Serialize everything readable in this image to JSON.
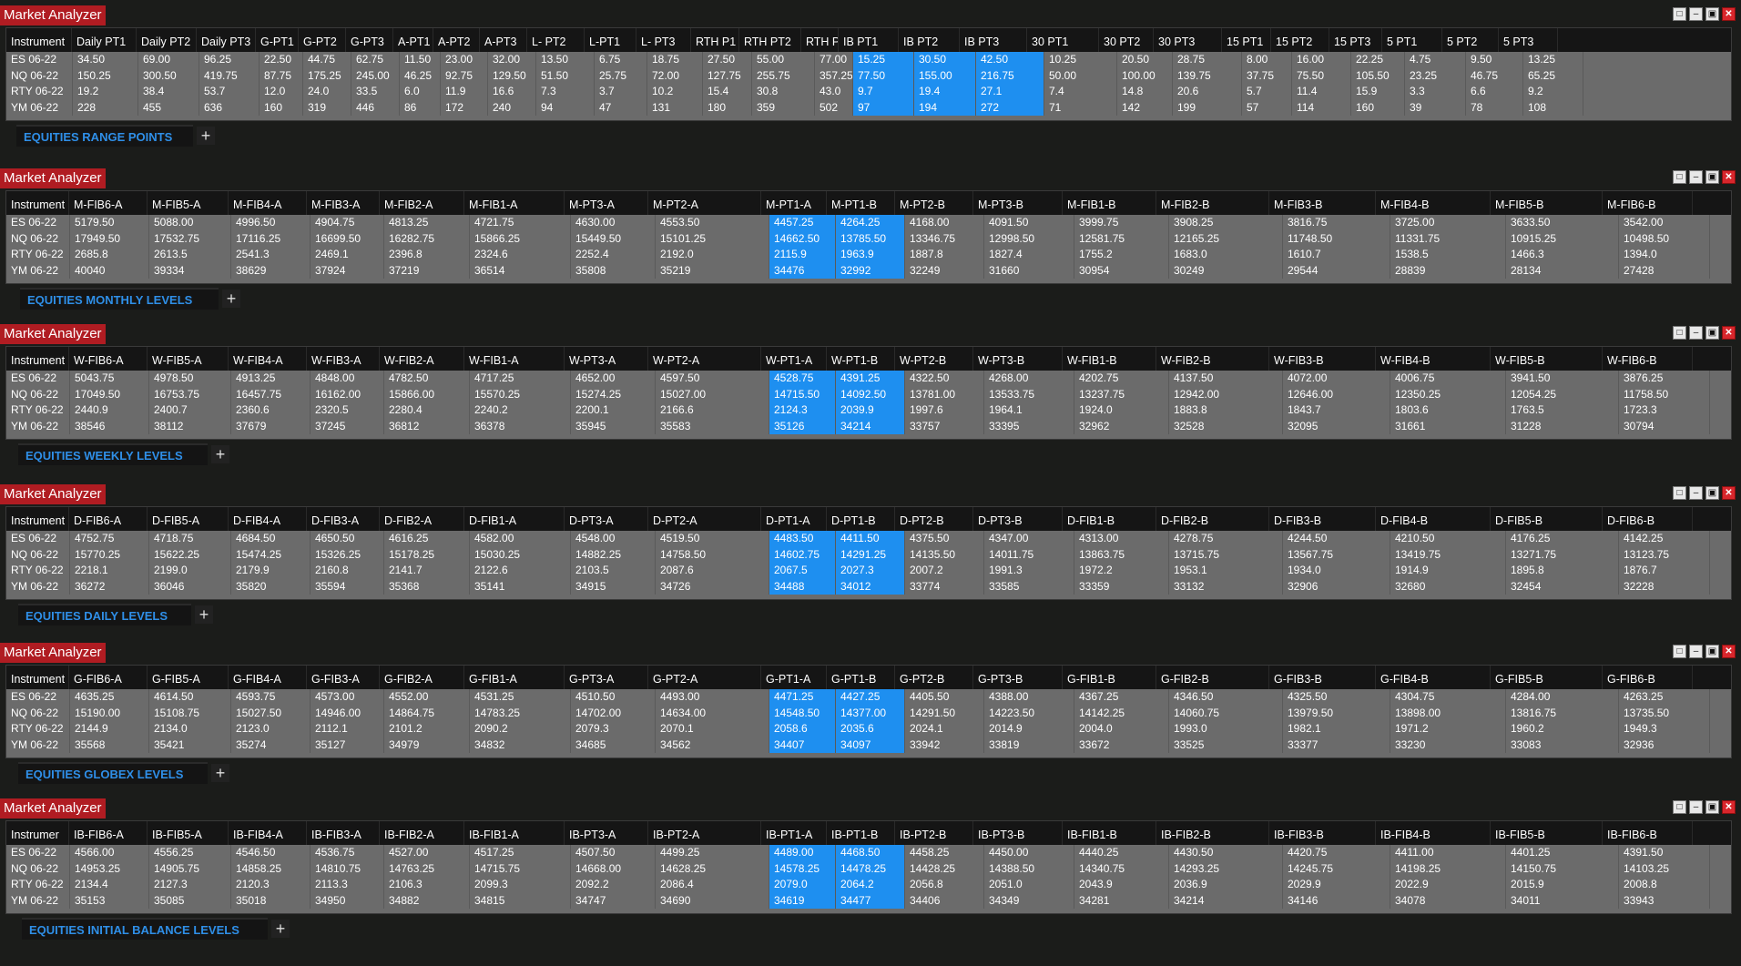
{
  "window_title": "Market Analyzer",
  "colors": {
    "title_bg": "#b01c22",
    "highlight": "#1e8ff0",
    "tab_text": "#2f8fe8",
    "grid_bg": "#6b6b6b"
  },
  "window_buttons": [
    "window-icon",
    "minimize-icon",
    "maximize-icon",
    "close-icon"
  ],
  "windows": [
    {
      "tab": "EQUITIES RANGE POINTS",
      "highlight_columns": [
        "IB PT1",
        "IB PT2",
        "IB PT3"
      ],
      "columns": [
        "Instrument",
        "Daily PT1",
        "Daily PT2",
        "Daily PT3",
        "G-PT1",
        "G-PT2",
        "G-PT3",
        "A-PT1",
        "A-PT2",
        "A-PT3",
        "L- PT2",
        "L-PT1",
        "L- PT3",
        "RTH P1",
        "RTH PT2",
        "RTH P",
        "IB PT1",
        "IB PT2",
        "IB PT3",
        "30 PT1",
        "30 PT2",
        "30 PT3",
        "15 PT1",
        "15 PT2",
        "15 PT3",
        "5 PT1",
        "5 PT2",
        "5 PT3"
      ],
      "rows": [
        [
          "ES 06-22",
          "34.50",
          "69.00",
          "96.25",
          "22.50",
          "44.75",
          "62.75",
          "11.50",
          "23.00",
          "32.00",
          "13.50",
          "6.75",
          "18.75",
          "27.50",
          "55.00",
          "77.00",
          "15.25",
          "30.50",
          "42.50",
          "10.25",
          "20.50",
          "28.75",
          "8.00",
          "16.00",
          "22.25",
          "4.75",
          "9.50",
          "13.25"
        ],
        [
          "NQ 06-22",
          "150.25",
          "300.50",
          "419.75",
          "87.75",
          "175.25",
          "245.00",
          "46.25",
          "92.75",
          "129.50",
          "51.50",
          "25.75",
          "72.00",
          "127.75",
          "255.75",
          "357.25",
          "77.50",
          "155.00",
          "216.75",
          "50.00",
          "100.00",
          "139.75",
          "37.75",
          "75.50",
          "105.50",
          "23.25",
          "46.75",
          "65.25"
        ],
        [
          "RTY 06-22",
          "19.2",
          "38.4",
          "53.7",
          "12.0",
          "24.0",
          "33.5",
          "6.0",
          "11.9",
          "16.6",
          "7.3",
          "3.7",
          "10.2",
          "15.4",
          "30.8",
          "43.0",
          "9.7",
          "19.4",
          "27.1",
          "7.4",
          "14.8",
          "20.6",
          "5.7",
          "11.4",
          "15.9",
          "3.3",
          "6.6",
          "9.2"
        ],
        [
          "YM 06-22",
          "228",
          "455",
          "636",
          "160",
          "319",
          "446",
          "86",
          "172",
          "240",
          "94",
          "47",
          "131",
          "180",
          "359",
          "502",
          "97",
          "194",
          "272",
          "71",
          "142",
          "199",
          "57",
          "114",
          "160",
          "39",
          "78",
          "108"
        ]
      ]
    },
    {
      "tab": "EQUITIES MONTHLY LEVELS",
      "highlight_columns": [
        "M-PT1-A",
        "M-PT1-B"
      ],
      "columns": [
        "Instrument",
        "M-FIB6-A",
        "M-FIB5-A",
        "M-FIB4-A",
        "M-FIB3-A",
        "M-FIB2-A",
        "M-FIB1-A",
        "M-PT3-A",
        "M-PT2-A",
        "M-PT1-A",
        "M-PT1-B",
        "M-PT2-B",
        "M-PT3-B",
        "M-FIB1-B",
        "M-FIB2-B",
        "M-FIB3-B",
        "M-FIB4-B",
        "M-FIB5-B",
        "M-FIB6-B"
      ],
      "rows": [
        [
          "ES 06-22",
          "5179.50",
          "5088.00",
          "4996.50",
          "4904.75",
          "4813.25",
          "4721.75",
          "4630.00",
          "4553.50",
          "4457.25",
          "4264.25",
          "4168.00",
          "4091.50",
          "3999.75",
          "3908.25",
          "3816.75",
          "3725.00",
          "3633.50",
          "3542.00"
        ],
        [
          "NQ 06-22",
          "17949.50",
          "17532.75",
          "17116.25",
          "16699.50",
          "16282.75",
          "15866.25",
          "15449.50",
          "15101.25",
          "14662.50",
          "13785.50",
          "13346.75",
          "12998.50",
          "12581.75",
          "12165.25",
          "11748.50",
          "11331.75",
          "10915.25",
          "10498.50"
        ],
        [
          "RTY 06-22",
          "2685.8",
          "2613.5",
          "2541.3",
          "2469.1",
          "2396.8",
          "2324.6",
          "2252.4",
          "2192.0",
          "2115.9",
          "1963.9",
          "1887.8",
          "1827.4",
          "1755.2",
          "1683.0",
          "1610.7",
          "1538.5",
          "1466.3",
          "1394.0"
        ],
        [
          "YM 06-22",
          "40040",
          "39334",
          "38629",
          "37924",
          "37219",
          "36514",
          "35808",
          "35219",
          "34476",
          "32992",
          "32249",
          "31660",
          "30954",
          "30249",
          "29544",
          "28839",
          "28134",
          "27428"
        ]
      ]
    },
    {
      "tab": "EQUITIES WEEKLY LEVELS",
      "highlight_columns": [
        "W-PT1-A",
        "W-PT1-B"
      ],
      "columns": [
        "Instrument",
        "W-FIB6-A",
        "W-FIB5-A",
        "W-FIB4-A",
        "W-FIB3-A",
        "W-FIB2-A",
        "W-FIB1-A",
        "W-PT3-A",
        "W-PT2-A",
        "W-PT1-A",
        "W-PT1-B",
        "W-PT2-B",
        "W-PT3-B",
        "W-FIB1-B",
        "W-FIB2-B",
        "W-FIB3-B",
        "W-FIB4-B",
        "W-FIB5-B",
        "W-FIB6-B"
      ],
      "rows": [
        [
          "ES 06-22",
          "5043.75",
          "4978.50",
          "4913.25",
          "4848.00",
          "4782.50",
          "4717.25",
          "4652.00",
          "4597.50",
          "4528.75",
          "4391.25",
          "4322.50",
          "4268.00",
          "4202.75",
          "4137.50",
          "4072.00",
          "4006.75",
          "3941.50",
          "3876.25"
        ],
        [
          "NQ 06-22",
          "17049.50",
          "16753.75",
          "16457.75",
          "16162.00",
          "15866.00",
          "15570.25",
          "15274.25",
          "15027.00",
          "14715.50",
          "14092.50",
          "13781.00",
          "13533.75",
          "13237.75",
          "12942.00",
          "12646.00",
          "12350.25",
          "12054.25",
          "11758.50"
        ],
        [
          "RTY 06-22",
          "2440.9",
          "2400.7",
          "2360.6",
          "2320.5",
          "2280.4",
          "2240.2",
          "2200.1",
          "2166.6",
          "2124.3",
          "2039.9",
          "1997.6",
          "1964.1",
          "1924.0",
          "1883.8",
          "1843.7",
          "1803.6",
          "1763.5",
          "1723.3"
        ],
        [
          "YM 06-22",
          "38546",
          "38112",
          "37679",
          "37245",
          "36812",
          "36378",
          "35945",
          "35583",
          "35126",
          "34214",
          "33757",
          "33395",
          "32962",
          "32528",
          "32095",
          "31661",
          "31228",
          "30794"
        ]
      ]
    },
    {
      "tab": "EQUITIES DAILY LEVELS",
      "highlight_columns": [
        "D-PT1-A",
        "D-PT1-B"
      ],
      "columns": [
        "Instrument",
        "D-FIB6-A",
        "D-FIB5-A",
        "D-FIB4-A",
        "D-FIB3-A",
        "D-FIB2-A",
        "D-FIB1-A",
        "D-PT3-A",
        "D-PT2-A",
        "D-PT1-A",
        "D-PT1-B",
        "D-PT2-B",
        "D-PT3-B",
        "D-FIB1-B",
        "D-FIB2-B",
        "D-FIB3-B",
        "D-FIB4-B",
        "D-FIB5-B",
        "D-FIB6-B"
      ],
      "rows": [
        [
          "ES 06-22",
          "4752.75",
          "4718.75",
          "4684.50",
          "4650.50",
          "4616.25",
          "4582.00",
          "4548.00",
          "4519.50",
          "4483.50",
          "4411.50",
          "4375.50",
          "4347.00",
          "4313.00",
          "4278.75",
          "4244.50",
          "4210.50",
          "4176.25",
          "4142.25"
        ],
        [
          "NQ 06-22",
          "15770.25",
          "15622.25",
          "15474.25",
          "15326.25",
          "15178.25",
          "15030.25",
          "14882.25",
          "14758.50",
          "14602.75",
          "14291.25",
          "14135.50",
          "14011.75",
          "13863.75",
          "13715.75",
          "13567.75",
          "13419.75",
          "13271.75",
          "13123.75"
        ],
        [
          "RTY 06-22",
          "2218.1",
          "2199.0",
          "2179.9",
          "2160.8",
          "2141.7",
          "2122.6",
          "2103.5",
          "2087.6",
          "2067.5",
          "2027.3",
          "2007.2",
          "1991.3",
          "1972.2",
          "1953.1",
          "1934.0",
          "1914.9",
          "1895.8",
          "1876.7"
        ],
        [
          "YM 06-22",
          "36272",
          "36046",
          "35820",
          "35594",
          "35368",
          "35141",
          "34915",
          "34726",
          "34488",
          "34012",
          "33774",
          "33585",
          "33359",
          "33132",
          "32906",
          "32680",
          "32454",
          "32228"
        ]
      ]
    },
    {
      "tab": "EQUITIES GLOBEX LEVELS",
      "highlight_columns": [
        "G-PT1-A",
        "G-PT1-B"
      ],
      "columns": [
        "Instrument",
        "G-FIB6-A",
        "G-FIB5-A",
        "G-FIB4-A",
        "G-FIB3-A",
        "G-FIB2-A",
        "G-FIB1-A",
        "G-PT3-A",
        "G-PT2-A",
        "G-PT1-A",
        "G-PT1-B",
        "G-PT2-B",
        "G-PT3-B",
        "G-FIB1-B",
        "G-FIB2-B",
        "G-FIB3-B",
        "G-FIB4-B",
        "G-FIB5-B",
        "G-FIB6-B"
      ],
      "rows": [
        [
          "ES 06-22",
          "4635.25",
          "4614.50",
          "4593.75",
          "4573.00",
          "4552.00",
          "4531.25",
          "4510.50",
          "4493.00",
          "4471.25",
          "4427.25",
          "4405.50",
          "4388.00",
          "4367.25",
          "4346.50",
          "4325.50",
          "4304.75",
          "4284.00",
          "4263.25"
        ],
        [
          "NQ 06-22",
          "15190.00",
          "15108.75",
          "15027.50",
          "14946.00",
          "14864.75",
          "14783.25",
          "14702.00",
          "14634.00",
          "14548.50",
          "14377.00",
          "14291.50",
          "14223.50",
          "14142.25",
          "14060.75",
          "13979.50",
          "13898.00",
          "13816.75",
          "13735.50"
        ],
        [
          "RTY 06-22",
          "2144.9",
          "2134.0",
          "2123.0",
          "2112.1",
          "2101.2",
          "2090.2",
          "2079.3",
          "2070.1",
          "2058.6",
          "2035.6",
          "2024.1",
          "2014.9",
          "2004.0",
          "1993.0",
          "1982.1",
          "1971.2",
          "1960.2",
          "1949.3"
        ],
        [
          "YM 06-22",
          "35568",
          "35421",
          "35274",
          "35127",
          "34979",
          "34832",
          "34685",
          "34562",
          "34407",
          "34097",
          "33942",
          "33819",
          "33672",
          "33525",
          "33377",
          "33230",
          "33083",
          "32936"
        ]
      ]
    },
    {
      "tab": "EQUITIES INITIAL BALANCE LEVELS",
      "highlight_columns": [
        "IB-PT1-A",
        "IB-PT1-B"
      ],
      "columns": [
        "Instrumer",
        "IB-FIB6-A",
        "IB-FIB5-A",
        "IB-FIB4-A",
        "IB-FIB3-A",
        "IB-FIB2-A",
        "IB-FIB1-A",
        "IB-PT3-A",
        "IB-PT2-A",
        "IB-PT1-A",
        "IB-PT1-B",
        "IB-PT2-B",
        "IB-PT3-B",
        "IB-FIB1-B",
        "IB-FIB2-B",
        "IB-FIB3-B",
        "IB-FIB4-B",
        "IB-FIB5-B",
        "IB-FIB6-B"
      ],
      "rows": [
        [
          "ES 06-22",
          "4566.00",
          "4556.25",
          "4546.50",
          "4536.75",
          "4527.00",
          "4517.25",
          "4507.50",
          "4499.25",
          "4489.00",
          "4468.50",
          "4458.25",
          "4450.00",
          "4440.25",
          "4430.50",
          "4420.75",
          "4411.00",
          "4401.25",
          "4391.50"
        ],
        [
          "NQ 06-22",
          "14953.25",
          "14905.75",
          "14858.25",
          "14810.75",
          "14763.25",
          "14715.75",
          "14668.00",
          "14628.25",
          "14578.25",
          "14478.25",
          "14428.25",
          "14388.50",
          "14340.75",
          "14293.25",
          "14245.75",
          "14198.25",
          "14150.75",
          "14103.25"
        ],
        [
          "RTY 06-22",
          "2134.4",
          "2127.3",
          "2120.3",
          "2113.3",
          "2106.3",
          "2099.3",
          "2092.2",
          "2086.4",
          "2079.0",
          "2064.2",
          "2056.8",
          "2051.0",
          "2043.9",
          "2036.9",
          "2029.9",
          "2022.9",
          "2015.9",
          "2008.8"
        ],
        [
          "YM 06-22",
          "35153",
          "35085",
          "35018",
          "34950",
          "34882",
          "34815",
          "34747",
          "34690",
          "34619",
          "34477",
          "34406",
          "34349",
          "34281",
          "34214",
          "34146",
          "34078",
          "34011",
          "33943"
        ]
      ]
    }
  ]
}
